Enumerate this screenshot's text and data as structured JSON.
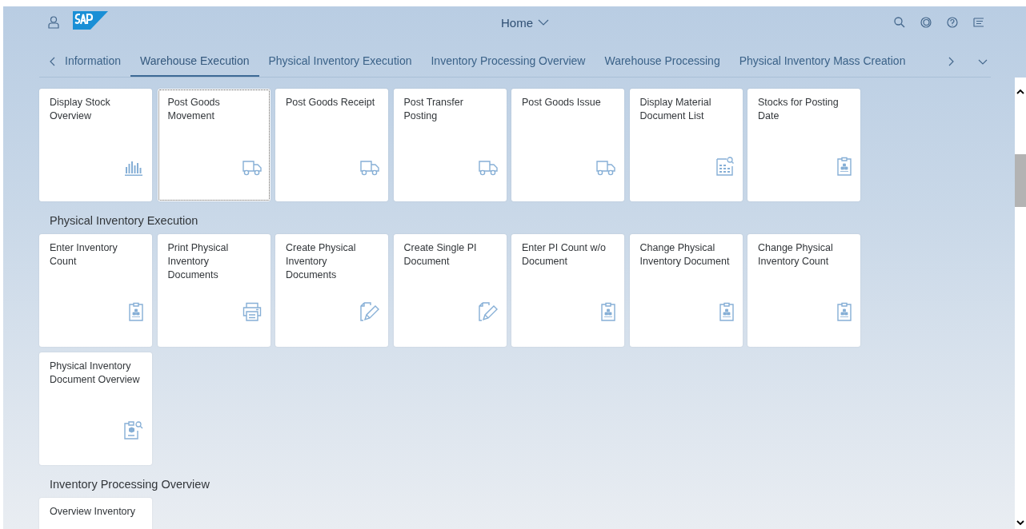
{
  "shell_header": {
    "title": "Home"
  },
  "tabs": [
    {
      "label": "Information",
      "selected": false
    },
    {
      "label": "Warehouse Execution",
      "selected": true
    },
    {
      "label": "Physical Inventory Execution",
      "selected": false
    },
    {
      "label": "Inventory Processing Overview",
      "selected": false
    },
    {
      "label": "Warehouse Processing",
      "selected": false
    },
    {
      "label": "Physical Inventory Mass Creation",
      "selected": false
    }
  ],
  "sections": [
    {
      "tiles": [
        {
          "title": "Display Stock Overview",
          "kind": "chart",
          "focused": false
        },
        {
          "title": "Post Goods Movement",
          "kind": "truck",
          "focused": true
        },
        {
          "title": "Post Goods Receipt",
          "kind": "truck",
          "focused": false
        },
        {
          "title": "Post Transfer Posting",
          "kind": "truck",
          "focused": false
        },
        {
          "title": "Post Goods Issue",
          "kind": "truck",
          "focused": false
        },
        {
          "title": "Display Material Document List",
          "kind": "report",
          "focused": false
        },
        {
          "title": "Stocks for Posting Date",
          "kind": "clipboard",
          "focused": false
        }
      ]
    },
    {
      "title": "Physical Inventory Execution",
      "tiles": [
        {
          "title": "Enter Inventory Count",
          "kind": "clipboard",
          "focused": false
        },
        {
          "title": "Print Physical Inventory Documents",
          "kind": "printer",
          "focused": false
        },
        {
          "title": "Create Physical Inventory Documents",
          "kind": "edit",
          "focused": false
        },
        {
          "title": "Create Single PI Document",
          "kind": "edit",
          "focused": false
        },
        {
          "title": "Enter PI Count w/o Document",
          "kind": "clipboard",
          "focused": false
        },
        {
          "title": "Change Physical Inventory Document",
          "kind": "clipboard",
          "focused": false
        },
        {
          "title": "Change Physical Inventory Count",
          "kind": "clipboard",
          "focused": false
        },
        {
          "title": "Physical Inventory Document Overview",
          "kind": "inspect",
          "focused": false
        }
      ]
    },
    {
      "title": "Inventory Processing Overview",
      "tiles": [
        {
          "title": "Overview Inventory",
          "kind": "none",
          "focused": false
        }
      ]
    }
  ]
}
